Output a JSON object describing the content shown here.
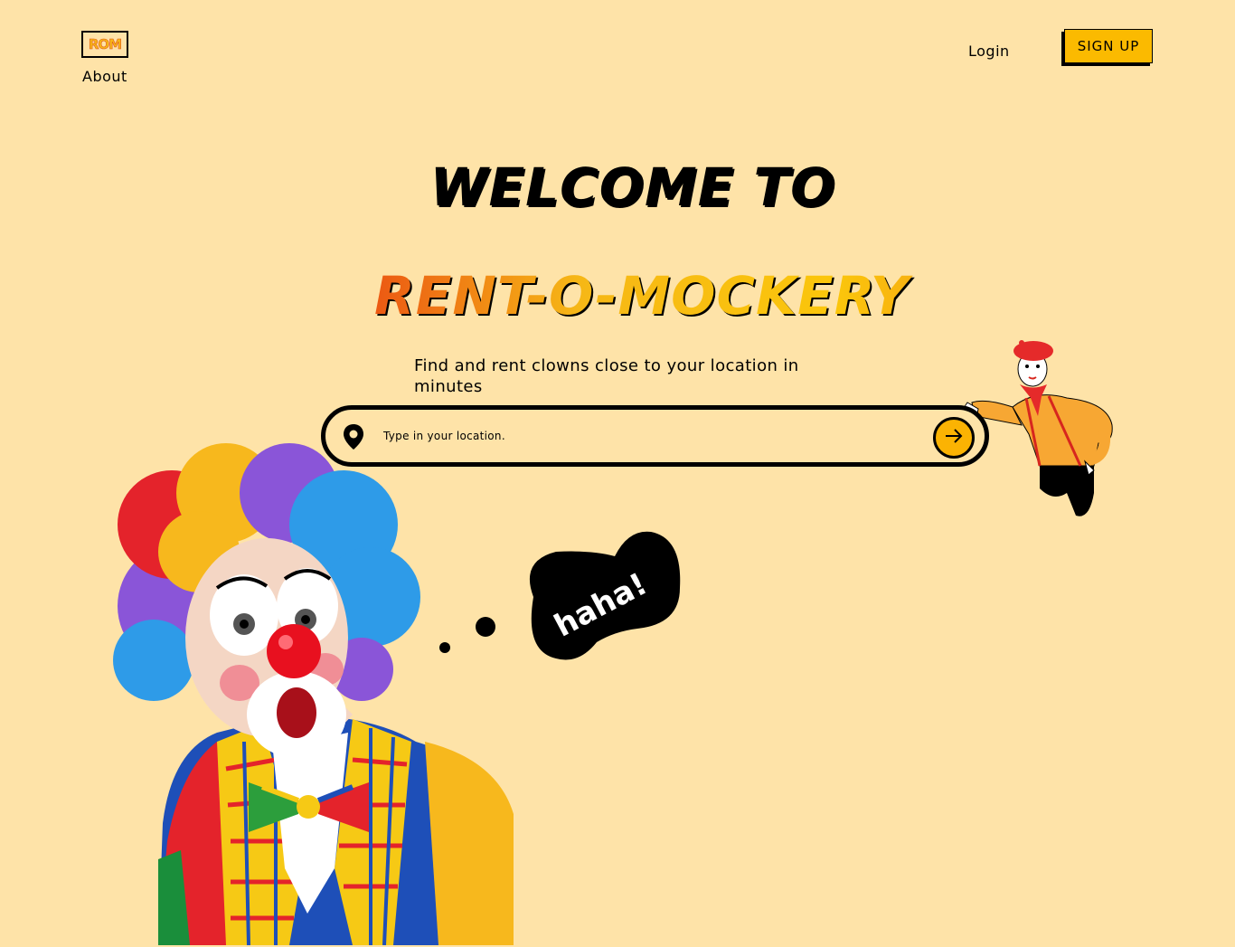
{
  "nav": {
    "logo_text": "ROM",
    "about_label": "About",
    "login_label": "Login",
    "signup_label": "SIGN UP"
  },
  "hero": {
    "welcome": "WELCOME TO",
    "brand": "RENT-O-MOCKERY",
    "tagline": "Find and rent clowns close to your location in minutes"
  },
  "search": {
    "placeholder": "Type in your location.",
    "value": "",
    "pin_icon": "location-pin-icon",
    "submit_icon": "arrow-right-icon"
  },
  "illustrations": {
    "bubble_text": "haha!"
  },
  "colors": {
    "background": "#FEE3A8",
    "accent": "#FBB303",
    "brand_red": "#E2070F",
    "brand_yellow": "#F6B716"
  }
}
